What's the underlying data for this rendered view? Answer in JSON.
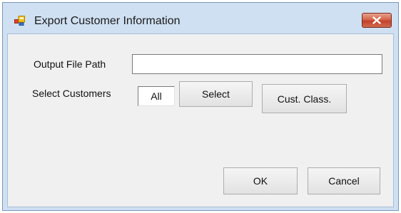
{
  "window": {
    "title": "Export Customer Information",
    "icon": "app-window-icon",
    "close_icon": "close-icon"
  },
  "form": {
    "output_path_label": "Output File Path",
    "output_path_value": "",
    "select_customers_label": "Select Customers",
    "selected_value": "All",
    "select_button": "Select",
    "cust_class_button": "Cust. Class."
  },
  "buttons": {
    "ok": "OK",
    "cancel": "Cancel"
  },
  "colors": {
    "title_bar": "#cfe0f2",
    "client_bg": "#f0f0f0",
    "close_button": "#c9452d"
  }
}
